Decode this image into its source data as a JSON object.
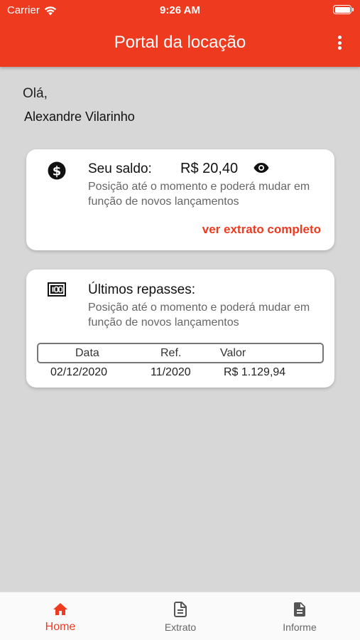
{
  "status_bar": {
    "carrier": "Carrier",
    "time": "9:26 AM",
    "wifi_icon": "wifi-icon",
    "battery_icon": "battery-icon"
  },
  "header": {
    "title": "Portal da locação",
    "menu_icon": "more-vertical-icon",
    "background_color": "#ee3a1f"
  },
  "greeting": {
    "salutation": "Olá,",
    "name": "Alexandre Vilarinho"
  },
  "balance_card": {
    "icon": "dollar-circle-icon",
    "title": "Seu saldo:",
    "value": "R$ 20,40",
    "visibility_icon": "eye-icon",
    "description": "Posição até o momento e poderá mudar em função de novos lançamentos",
    "link": "ver extrato completo"
  },
  "repasses_card": {
    "icon": "money-bill-icon",
    "title": "Últimos repasses:",
    "description": "Posição até o momento e poderá mudar em função de novos lançamentos",
    "table": {
      "headers": [
        "Data",
        "Ref.",
        "Valor"
      ],
      "rows": [
        [
          "02/12/2020",
          "11/2020",
          "R$ 1.129,94"
        ]
      ]
    }
  },
  "tab_bar": {
    "tabs": [
      {
        "label": "Home",
        "icon": "home-icon",
        "active": true
      },
      {
        "label": "Extrato",
        "icon": "document-outline-icon",
        "active": false
      },
      {
        "label": "Informe",
        "icon": "document-filled-icon",
        "active": false
      }
    ],
    "active_color": "#ee3a1f",
    "inactive_color": "#666666"
  }
}
